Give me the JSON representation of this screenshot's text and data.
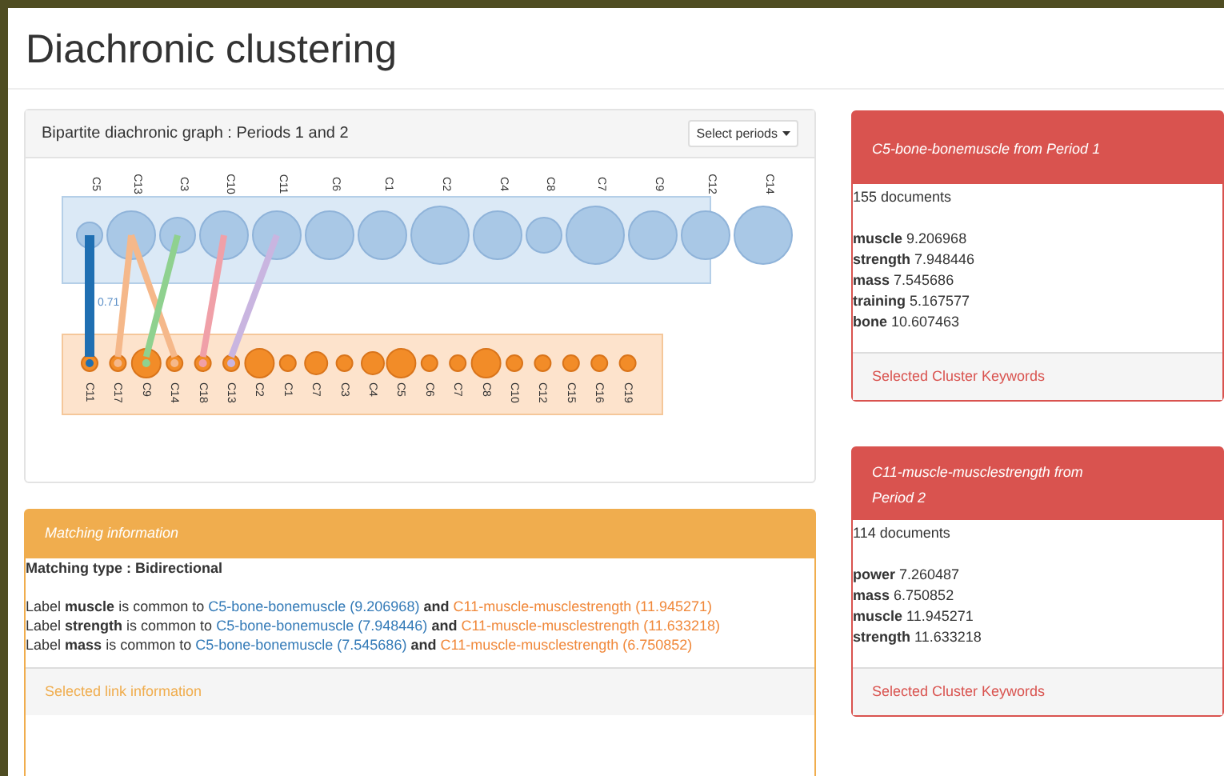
{
  "page_title": "Diachronic clustering",
  "graph_panel": {
    "title": "Bipartite diachronic graph : Periods 1 and 2",
    "dropdown": "Select periods",
    "top_nodes": [
      {
        "label": "C5",
        "kind": "small",
        "links": [
          {
            "color": "#1f6fb2",
            "weight": "0.71"
          }
        ]
      },
      {
        "label": "C13",
        "kind": "large",
        "links": [
          {
            "color": "#f5b88a"
          },
          {
            "color": "#f5b88a"
          }
        ]
      },
      {
        "label": "C3",
        "kind": "medium",
        "links": [
          {
            "color": "#8fd18f"
          }
        ]
      },
      {
        "label": "C10",
        "kind": "large",
        "links": [
          {
            "color": "#f0a0a8"
          }
        ]
      },
      {
        "label": "C11",
        "kind": "large",
        "links": [
          {
            "color": "#c9b5e0"
          }
        ]
      },
      {
        "label": "C6",
        "kind": "large"
      },
      {
        "label": "C1",
        "kind": "large"
      },
      {
        "label": "C2",
        "kind": "xlarge"
      },
      {
        "label": "C4",
        "kind": "large"
      },
      {
        "label": "C8",
        "kind": "medium"
      },
      {
        "label": "C7",
        "kind": "xlarge"
      },
      {
        "label": "C9",
        "kind": "large"
      },
      {
        "label": "C12",
        "kind": "large"
      },
      {
        "label": "C14",
        "kind": "xlarge"
      }
    ],
    "bottom_nodes": [
      {
        "label": "C11",
        "kind": "small",
        "link": {
          "color": "#1f6fb2"
        }
      },
      {
        "label": "C17",
        "kind": "small",
        "link": {
          "color": "#f5b88a"
        }
      },
      {
        "label": "C9",
        "kind": "large",
        "link": {
          "color": "#8fd18f"
        }
      },
      {
        "label": "C14",
        "kind": "small",
        "link": {
          "color": "#f5b88a"
        }
      },
      {
        "label": "C18",
        "kind": "small",
        "link": {
          "color": "#f0a0a8"
        }
      },
      {
        "label": "C13",
        "kind": "small",
        "link": {
          "color": "#c9b5e0"
        }
      },
      {
        "label": "C2",
        "kind": "large"
      },
      {
        "label": "C1",
        "kind": "small"
      },
      {
        "label": "C7",
        "kind": "medium"
      },
      {
        "label": "C3",
        "kind": "small"
      },
      {
        "label": "C4",
        "kind": "medium"
      },
      {
        "label": "C5",
        "kind": "large"
      },
      {
        "label": "C6",
        "kind": "small"
      },
      {
        "label": "C7",
        "kind": "small"
      },
      {
        "label": "C8",
        "kind": "large"
      },
      {
        "label": "C10",
        "kind": "small"
      },
      {
        "label": "C12",
        "kind": "small"
      },
      {
        "label": "C15",
        "kind": "small"
      },
      {
        "label": "C16",
        "kind": "small"
      },
      {
        "label": "C19",
        "kind": "small"
      }
    ]
  },
  "matching_panel": {
    "title": "Matching information",
    "type_label": "Matching type : Bidirectional",
    "rows": [
      {
        "prefix": "Label **muscle** is common to",
        "link_1": "C5-bone-bonemuscle (9.206968)",
        "middle": "and",
        "link_2": "C11-muscle-musclestrength (11.945271)"
      },
      {
        "prefix": "Label **strength** is common to",
        "link_1": "C5-bone-bonemuscle (7.948446)",
        "middle": "and",
        "link_2": "C11-muscle-musclestrength (11.633218)"
      },
      {
        "prefix": "Label **mass** is common to",
        "link_1": "C5-bone-bonemuscle (7.545686)",
        "middle": "and",
        "link_2": "C11-muscle-musclestrength (6.750852)"
      }
    ],
    "footer": "Selected link information"
  },
  "cluster_panels": [
    {
      "title": "C5-bone-bonemuscle from Period 1",
      "documents": "155 documents",
      "keywords": [
        {
          "term": "muscle",
          "value": "9.206968"
        },
        {
          "term": "strength",
          "value": "7.948446"
        },
        {
          "term": "mass",
          "value": "7.545686"
        },
        {
          "term": "training",
          "value": "5.167577"
        },
        {
          "term": "bone",
          "value": "10.607463"
        }
      ],
      "footer": "Selected Cluster Keywords"
    },
    {
      "title": "C11-muscle-musclestrength from Period 2",
      "documents": "114 documents",
      "keywords": [
        {
          "term": "power",
          "value": "7.260487"
        },
        {
          "term": "mass",
          "value": "6.750852"
        },
        {
          "term": "muscle",
          "value": "11.945271"
        },
        {
          "term": "strength",
          "value": "11.633218"
        }
      ],
      "footer": "Selected Cluster Keywords"
    }
  ]
}
